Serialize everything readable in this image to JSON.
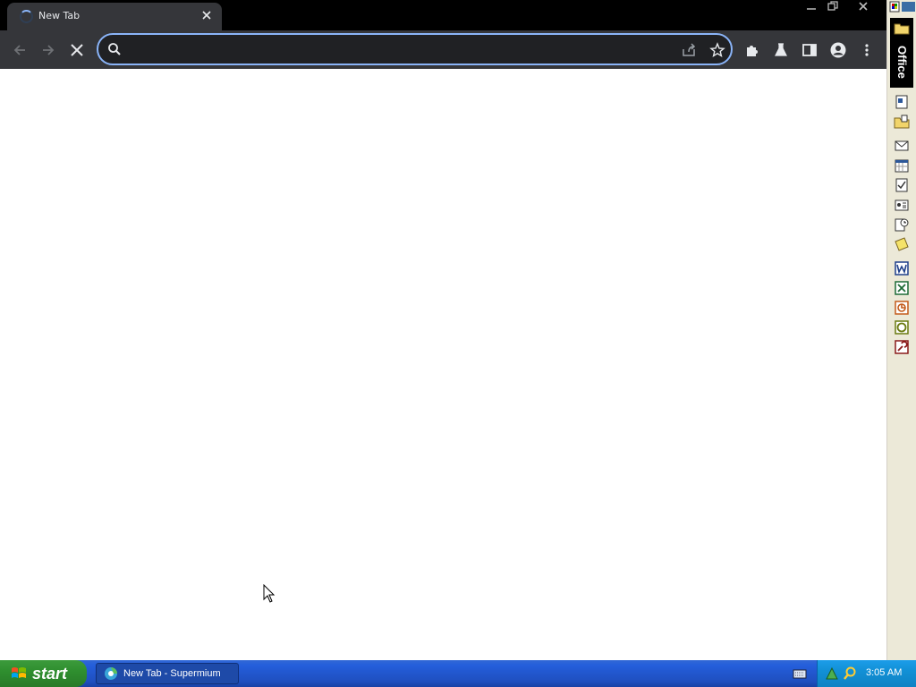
{
  "browser": {
    "tab_title": "New Tab",
    "omnibox_value": "",
    "omnibox_placeholder": ""
  },
  "office_bar": {
    "title": "Office",
    "buttons": [
      "folder-icon",
      "new-office-document-icon",
      "open-office-document-icon",
      "mail-icon",
      "calendar-icon",
      "tasks-icon",
      "contact-icon",
      "journal-icon",
      "note-icon",
      "word-icon",
      "excel-icon",
      "powerpoint-icon",
      "publisher-icon",
      "access-icon"
    ]
  },
  "taskbar": {
    "start_label": "start",
    "task_label": "New Tab - Supermium",
    "clock": "3:05 AM"
  },
  "colors": {
    "omnibox_focus": "#8ab4f8",
    "toolbar_bg": "#35363a",
    "taskbar_blue": "#245edb",
    "start_green": "#3c9b3c",
    "tray_blue": "#1290d6"
  }
}
